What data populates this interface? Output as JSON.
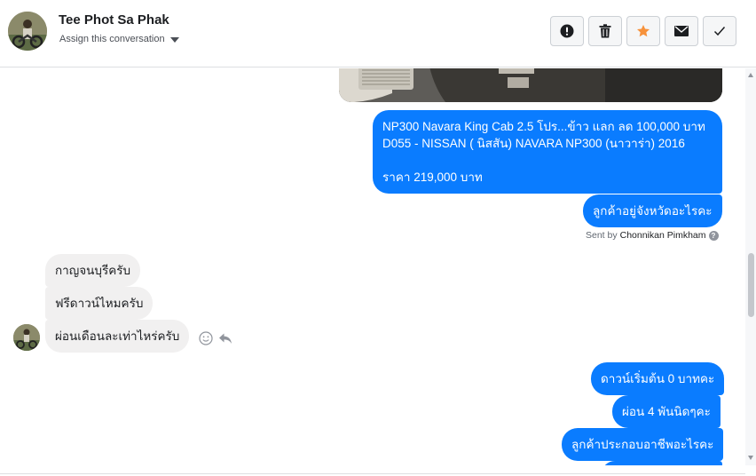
{
  "header": {
    "title": "Tee Phot Sa Phak",
    "assign_label": "Assign this conversation"
  },
  "actions": [
    {
      "name": "mark-spam-button",
      "icon": "exclamation-circle-icon"
    },
    {
      "name": "delete-button",
      "icon": "trash-icon"
    },
    {
      "name": "star-button",
      "icon": "star-icon"
    },
    {
      "name": "mark-unread-button",
      "icon": "envelope-icon"
    },
    {
      "name": "mark-done-button",
      "icon": "checkmark-icon"
    }
  ],
  "messages": {
    "listing_line1": "NP300 Navara King Cab 2.5 โปร...ข้าว แลก ลด 100,000 บาท",
    "listing_line2": "D055 - NISSAN ( นิสสัน) NAVARA NP300 (นาวาร่า) 2016",
    "listing_price": "ราคา 219,000 บาท",
    "out_province": "ลูกค้าอยู่จังหวัดอะไรคะ",
    "sent_by_prefix": "Sent by",
    "sent_by_name": "Chonnikan Pimkham",
    "in_1": "กาญจนบุรีครับ",
    "in_2": "ฟรีดาวน์ไหมครับ",
    "in_3": "ผ่อนเดือนละเท่าไหร่ครับ",
    "out_down": "ดาวน์เริ่มต้น 0 บาทคะ",
    "out_installment": "ผ่อน 4 พันนิดๆคะ",
    "out_occupation": "ลูกค้าประกอบอาชีพอะไรคะ"
  },
  "colors": {
    "outgoing_bubble": "#0a7cff",
    "incoming_bubble": "#f1f0f0",
    "star": "#f7923b"
  }
}
